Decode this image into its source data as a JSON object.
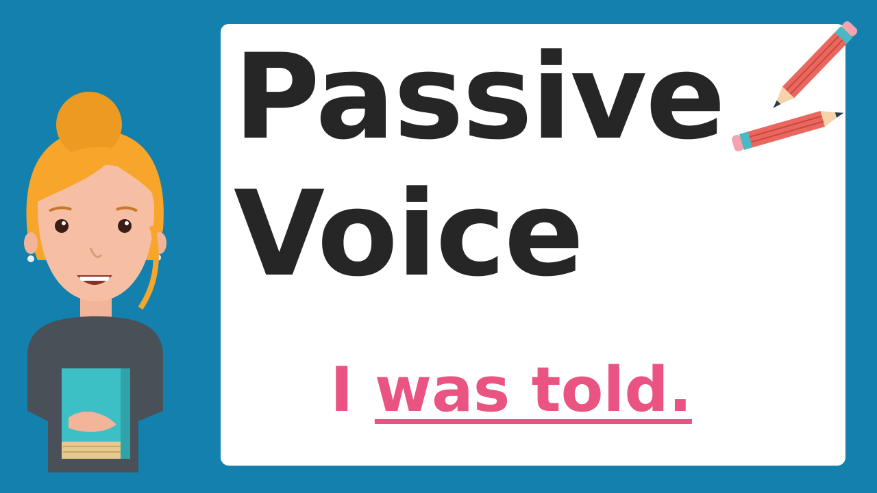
{
  "title": {
    "line1": "Passive",
    "line2": "Voice"
  },
  "example": {
    "pronoun": "I",
    "highlight": "was told."
  },
  "colors": {
    "background": "#1380ad",
    "card": "#ffffff",
    "title_text": "#262626",
    "example_text": "#e95482"
  },
  "icons": {
    "decoration": "pencil-icon",
    "character": "teacher-illustration"
  }
}
